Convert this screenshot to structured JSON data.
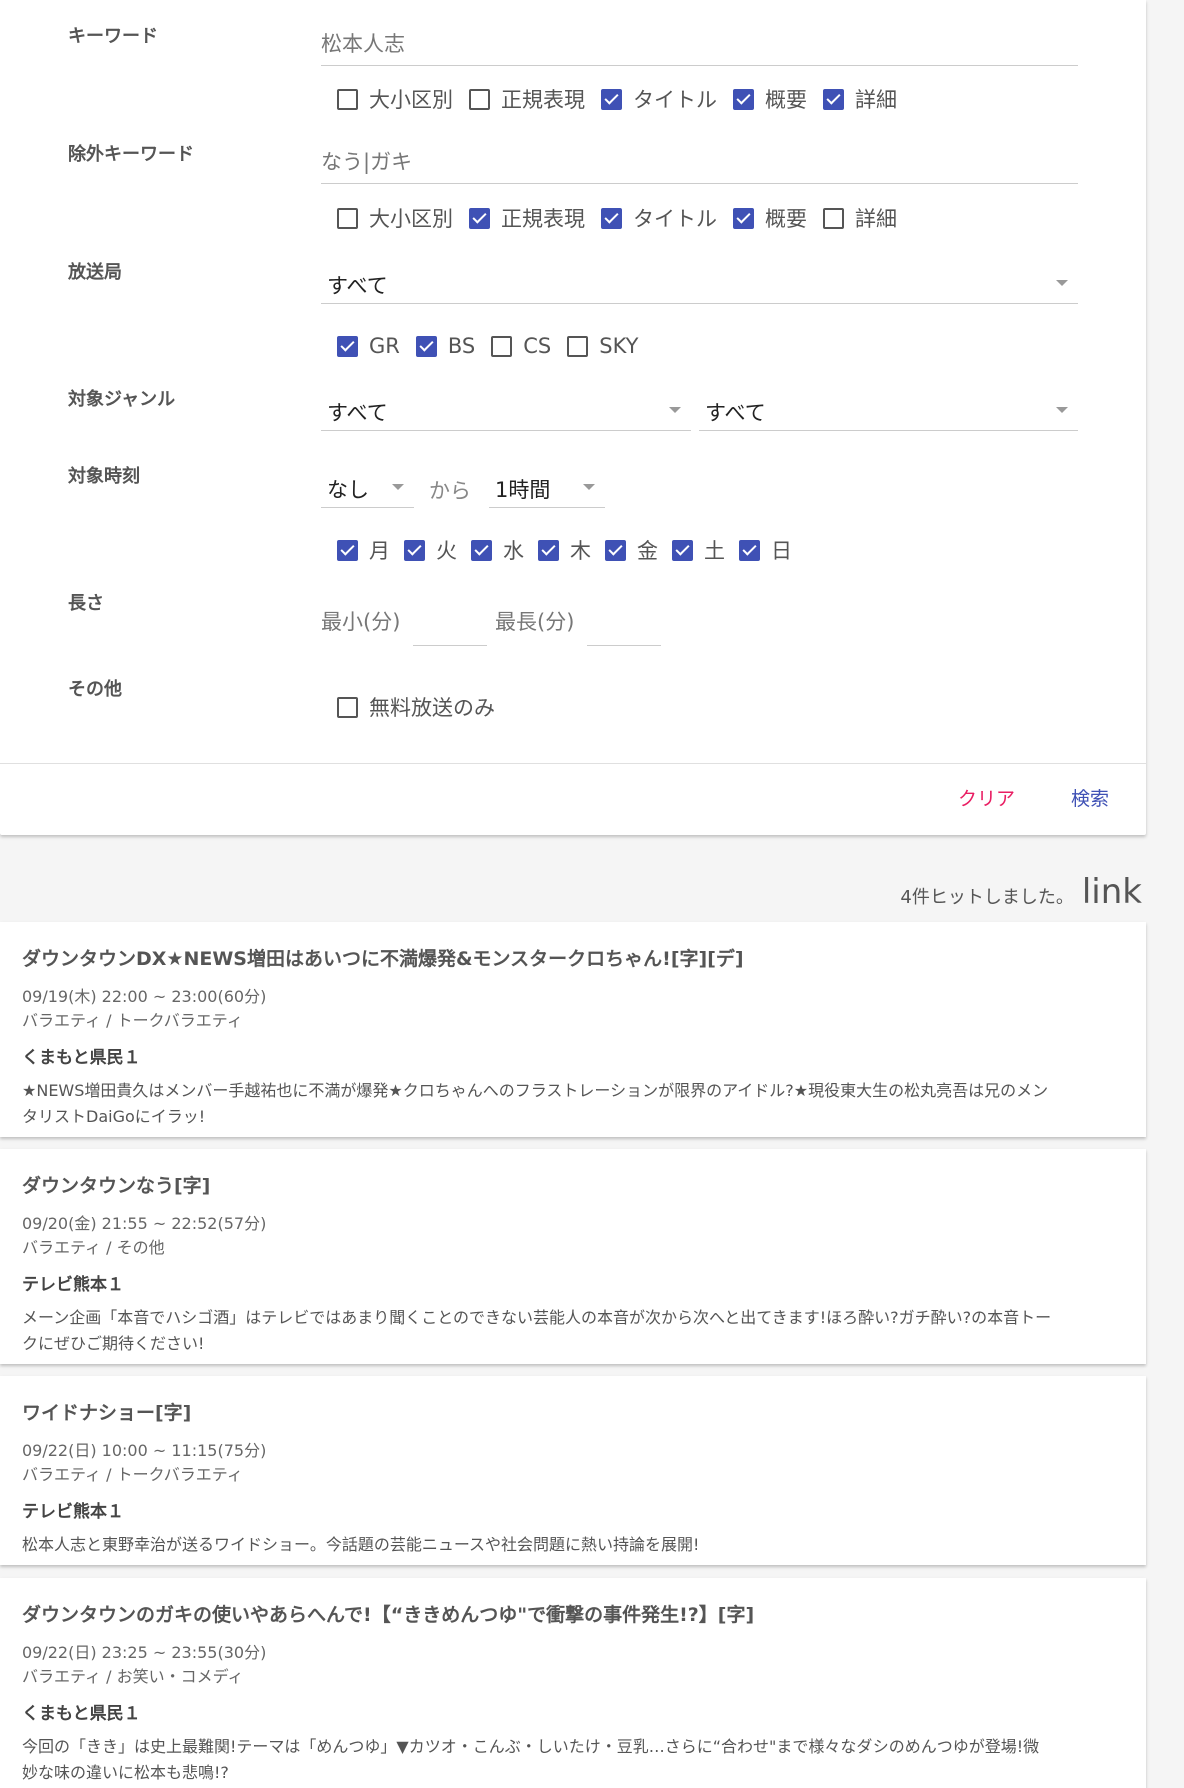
{
  "form": {
    "keyword": {
      "label": "キーワード",
      "value": "松本人志",
      "options": [
        {
          "label": "大小区別",
          "checked": false
        },
        {
          "label": "正規表現",
          "checked": false
        },
        {
          "label": "タイトル",
          "checked": true
        },
        {
          "label": "概要",
          "checked": true
        },
        {
          "label": "詳細",
          "checked": true
        }
      ]
    },
    "exclude_keyword": {
      "label": "除外キーワード",
      "value": "なう|ガキ",
      "options": [
        {
          "label": "大小区別",
          "checked": false
        },
        {
          "label": "正規表現",
          "checked": true
        },
        {
          "label": "タイトル",
          "checked": true
        },
        {
          "label": "概要",
          "checked": true
        },
        {
          "label": "詳細",
          "checked": false
        }
      ]
    },
    "station": {
      "label": "放送局",
      "value": "すべて",
      "options": [
        {
          "label": "GR",
          "checked": true
        },
        {
          "label": "BS",
          "checked": true
        },
        {
          "label": "CS",
          "checked": false
        },
        {
          "label": "SKY",
          "checked": false
        }
      ]
    },
    "genre": {
      "label": "対象ジャンル",
      "main": "すべて",
      "sub": "すべて"
    },
    "time": {
      "label": "対象時刻",
      "start": "なし",
      "from_label": "から",
      "duration": "1時間",
      "days": [
        {
          "label": "月",
          "checked": true
        },
        {
          "label": "火",
          "checked": true
        },
        {
          "label": "水",
          "checked": true
        },
        {
          "label": "木",
          "checked": true
        },
        {
          "label": "金",
          "checked": true
        },
        {
          "label": "土",
          "checked": true
        },
        {
          "label": "日",
          "checked": true
        }
      ]
    },
    "length": {
      "label": "長さ",
      "min_label": "最小(分)",
      "max_label": "最長(分)"
    },
    "other": {
      "label": "その他",
      "free_only": {
        "label": "無料放送のみ",
        "checked": false
      }
    },
    "buttons": {
      "clear": "クリア",
      "search": "検索"
    }
  },
  "results": {
    "count_text": "4件ヒットしました。",
    "link_text": "link",
    "items": [
      {
        "title": "ダウンタウンDX★NEWS増田はあいつに不満爆発&モンスタークロちゃん![字][デ]",
        "time": "09/19(木) 22:00 ~ 23:00(60分)",
        "genre": "バラエティ / トークバラエティ",
        "channel": "くまもと県民１",
        "desc": "★NEWS増田貴久はメンバー手越祐也に不満が爆発★クロちゃんへのフラストレーションが限界のアイドル?★現役東大生の松丸亮吾は兄のメンタリストDaiGoにイラッ!"
      },
      {
        "title": "ダウンタウンなう[字]",
        "time": "09/20(金) 21:55 ~ 22:52(57分)",
        "genre": "バラエティ / その他",
        "channel": "テレビ熊本１",
        "desc": "メーン企画「本音でハシゴ酒」はテレビではあまり聞くことのできない芸能人の本音が次から次へと出てきます!ほろ酔い?ガチ酔い?の本音トークにぜひご期待ください!"
      },
      {
        "title": "ワイドナショー[字]",
        "time": "09/22(日) 10:00 ~ 11:15(75分)",
        "genre": "バラエティ / トークバラエティ",
        "channel": "テレビ熊本１",
        "desc": "松本人志と東野幸治が送るワイドショー。今話題の芸能ニュースや社会問題に熱い持論を展開!"
      },
      {
        "title": "ダウンタウンのガキの使いやあらへんで!【“ききめんつゆ\"で衝撃の事件発生!?】[字]",
        "time": "09/22(日) 23:25 ~ 23:55(30分)",
        "genre": "バラエティ / お笑い・コメディ",
        "channel": "くまもと県民１",
        "desc": "今回の「きき」は史上最難関!テーマは「めんつゆ」▼カツオ・こんぶ・しいたけ・豆乳…さらに“合わせ\"まで様々なダシのめんつゆが登場!微妙な味の違いに松本も悲鳴!?"
      }
    ]
  }
}
